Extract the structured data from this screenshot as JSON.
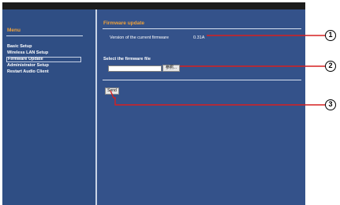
{
  "sidebar": {
    "title": "Menu",
    "items": [
      {
        "label": "Basic Setup",
        "active": false
      },
      {
        "label": "Wireless LAN Setup",
        "active": false
      },
      {
        "label": "Firmware Update",
        "active": true
      },
      {
        "label": "Administrator Setup",
        "active": false
      },
      {
        "label": "Restart Audio Client",
        "active": false
      }
    ]
  },
  "main": {
    "title": "Firmware update",
    "version_label": "Version of the current firmware",
    "version_value": "0.31A",
    "select_label": "Select the firmware file",
    "file_input_value": "",
    "browse_label": "参照...",
    "send_label": "Send"
  },
  "callouts": [
    "1",
    "2",
    "3"
  ],
  "colors": {
    "background": "#34528a",
    "heading": "#f0a23a",
    "callout_line": "#d62020"
  }
}
